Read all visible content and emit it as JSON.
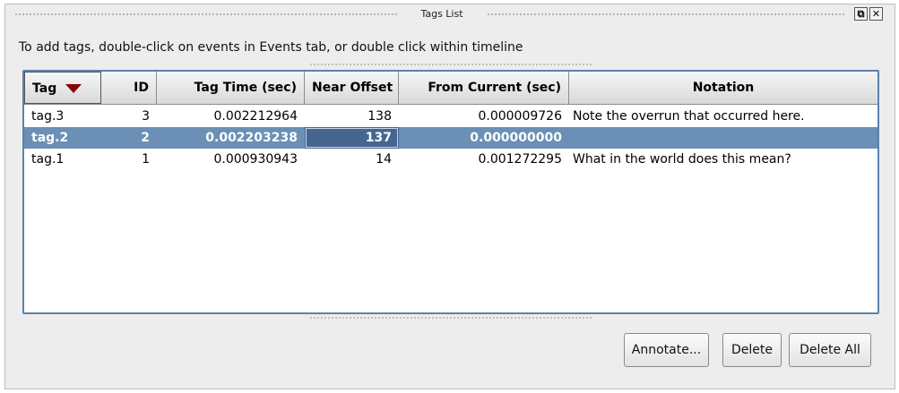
{
  "window": {
    "title": "Tags List",
    "float_icon": "⧉",
    "close_icon": "✕"
  },
  "instructions": "To add tags, double-click on events in Events tab, or double click within timeline",
  "table": {
    "columns": [
      {
        "label": "Tag",
        "sorted": "descending"
      },
      {
        "label": "ID"
      },
      {
        "label": "Tag Time (sec)"
      },
      {
        "label": "Near Offset"
      },
      {
        "label": "From Current (sec)"
      },
      {
        "label": "Notation"
      }
    ],
    "rows": [
      {
        "tag": "tag.3",
        "id": "3",
        "tag_time": "0.002212964",
        "near_offset": "138",
        "from_current": "0.000009726",
        "notation": "Note the overrun that occurred here.",
        "selected": false
      },
      {
        "tag": "tag.2",
        "id": "2",
        "tag_time": "0.002203238",
        "near_offset": "137",
        "from_current": "0.000000000",
        "notation": "",
        "selected": true
      },
      {
        "tag": "tag.1",
        "id": "1",
        "tag_time": "0.000930943",
        "near_offset": "14",
        "from_current": "0.001272295",
        "notation": "What in the world does this mean?",
        "selected": false
      }
    ]
  },
  "buttons": {
    "annotate": "Annotate...",
    "delete": "Delete",
    "delete_all": "Delete All"
  },
  "colors": {
    "selection": "#6b8fb5",
    "table_border": "#5a82ad",
    "sort_arrow": "#8b0000"
  }
}
